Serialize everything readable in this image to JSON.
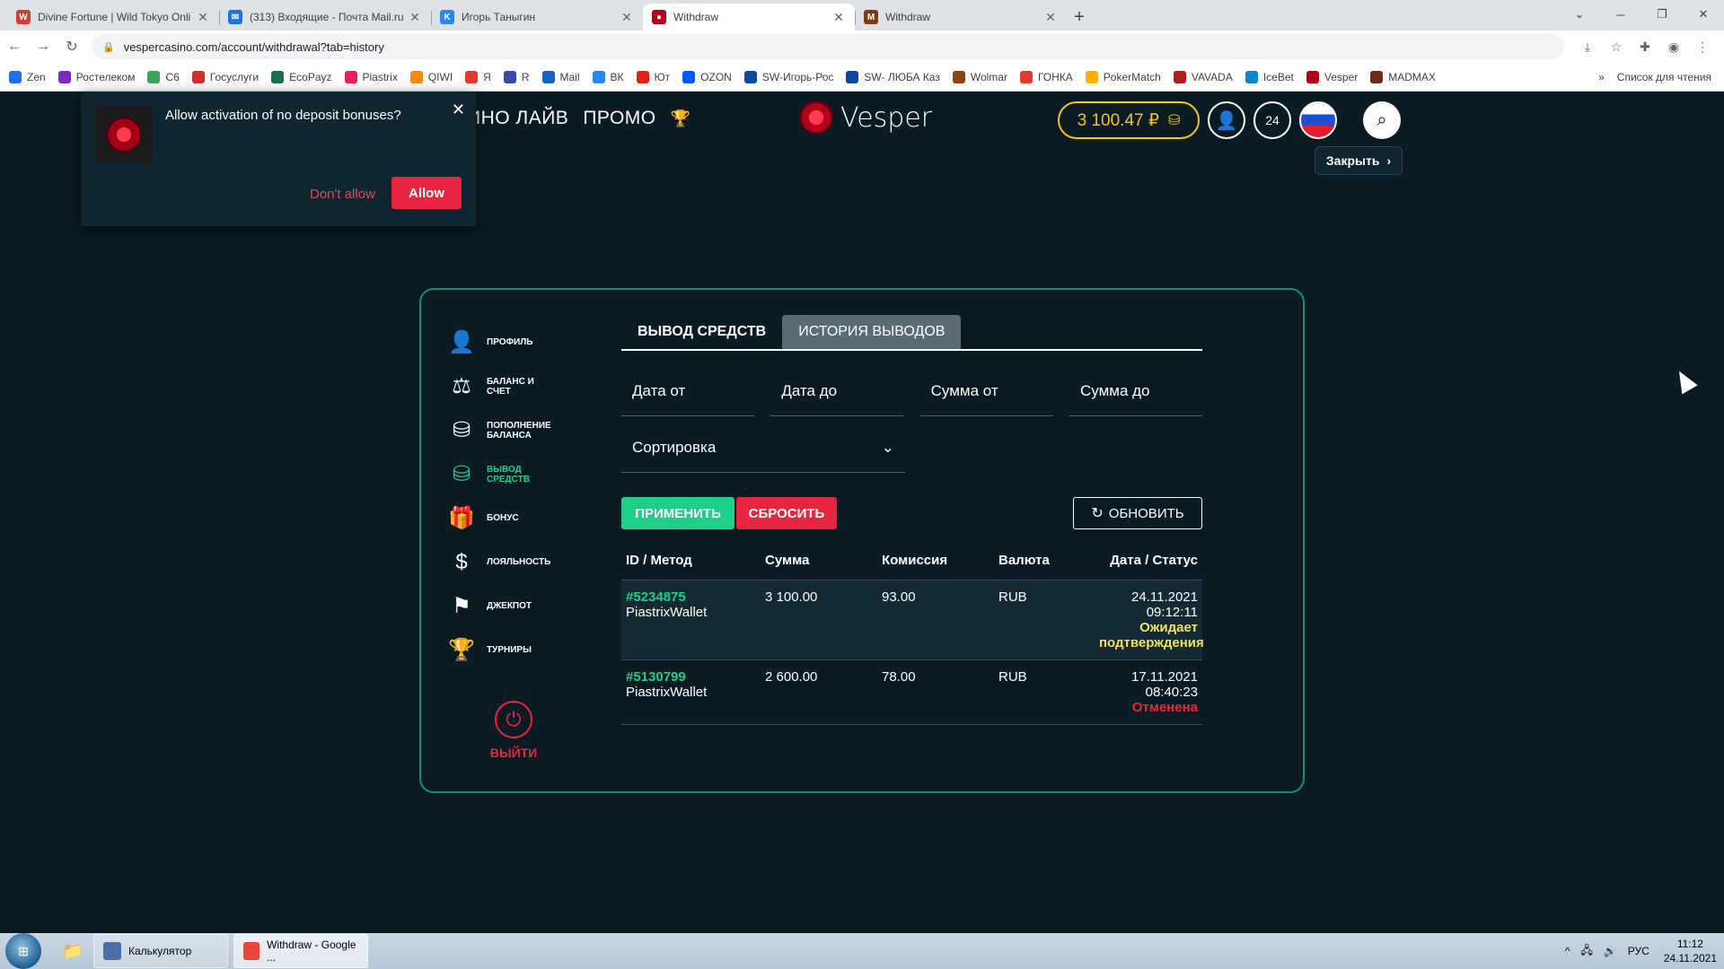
{
  "browser": {
    "tabs": [
      {
        "title": "Divine Fortune | Wild Tokyo Onli",
        "color": "#d23f31",
        "glyph": "W"
      },
      {
        "title": "(313) Входящие - Почта Mail.ru",
        "color": "#1a73e8",
        "glyph": "✉"
      },
      {
        "title": "Игорь Таныгин",
        "color": "#2787f5",
        "glyph": "K"
      },
      {
        "title": "Withdraw",
        "color": "#b3001b",
        "glyph": "●"
      },
      {
        "title": "Withdraw",
        "color": "#7a3b16",
        "glyph": "M"
      }
    ],
    "active_tab": 3,
    "url": "vespercasino.com/account/withdrawal?tab=history",
    "bookmarks": [
      {
        "label": "Zen",
        "color": "#1a73e8"
      },
      {
        "label": "Ростелеком",
        "color": "#7b2cbf"
      },
      {
        "label": "C6",
        "color": "#3aa657"
      },
      {
        "label": "Госуслуги",
        "color": "#d32f2f"
      },
      {
        "label": "EcoPayz",
        "color": "#1c6e4f"
      },
      {
        "label": "Piastrix",
        "color": "#e91e63"
      },
      {
        "label": "QIWI",
        "color": "#ff8c00"
      },
      {
        "label": "Я",
        "color": "#e53935"
      },
      {
        "label": "R",
        "color": "#3949ab"
      },
      {
        "label": "Mail",
        "color": "#1565c0"
      },
      {
        "label": "ВК",
        "color": "#2787f5"
      },
      {
        "label": "Ют",
        "color": "#e62117"
      },
      {
        "label": "OZON",
        "color": "#005bff"
      },
      {
        "label": "SW-Игорь-Рос",
        "color": "#0d47a1"
      },
      {
        "label": "SW- ЛЮБА Каз",
        "color": "#0d47a1"
      },
      {
        "label": "Wolmar",
        "color": "#8b4513"
      },
      {
        "label": "ГОНКА",
        "color": "#e53935"
      },
      {
        "label": "PokerMatch",
        "color": "#ffb300"
      },
      {
        "label": "VAVADA",
        "color": "#b71c1c"
      },
      {
        "label": "IceBet",
        "color": "#0288d1"
      },
      {
        "label": "Vesper",
        "color": "#b3001b"
      },
      {
        "label": "MADMAX",
        "color": "#6d2c14"
      }
    ],
    "more_glyph": "»",
    "reading_list": "Список для чтения"
  },
  "site": {
    "nav": [
      "ИНО ЛАЙВ",
      "ПРОМО"
    ],
    "logo": "Vesper",
    "balance": "3 100.47 ₽",
    "close_label": "Закрыть"
  },
  "notification": {
    "text": "Allow activation of no deposit bonuses?",
    "deny": "Don't allow",
    "allow": "Allow"
  },
  "sidebar": {
    "items": [
      {
        "label": "Профиль",
        "icon": "👤",
        "name": "profile",
        "active": false
      },
      {
        "label": "Баланс и счет",
        "icon": "⚖",
        "name": "balance",
        "active": false
      },
      {
        "label": "Пополнение баланса",
        "icon": "⛁",
        "name": "deposit",
        "active": false
      },
      {
        "label": "Вывод средств",
        "icon": "⛁",
        "name": "withdraw",
        "active": true
      },
      {
        "label": "Бонус",
        "icon": "🎁",
        "name": "bonus",
        "active": false
      },
      {
        "label": "Лояльность",
        "icon": "$",
        "name": "loyalty",
        "active": false
      },
      {
        "label": "Джекпот",
        "icon": "⚑",
        "name": "jackpot",
        "active": false
      },
      {
        "label": "Турниры",
        "icon": "🏆",
        "name": "tournaments",
        "active": false
      }
    ],
    "logout": "ВЫЙТИ"
  },
  "main": {
    "tabs": [
      {
        "label": "ВЫВОД СРЕДСТВ",
        "active": false
      },
      {
        "label": "ИСТОРИЯ ВЫВОДОВ",
        "active": true
      }
    ],
    "filters": {
      "date_from": "Дата от",
      "date_to": "Дата до",
      "sum_from": "Сумма от",
      "sum_to": "Сумма до",
      "sort": "Сортировка"
    },
    "buttons": {
      "apply": "ПРИМЕНИТЬ",
      "reset": "СБРОСИТЬ",
      "refresh": "ОБНОВИТЬ"
    },
    "table": {
      "headers": [
        "ID / Метод",
        "Сумма",
        "Комиссия",
        "Валюта",
        "Дата / Статус"
      ],
      "rows": [
        {
          "id": "#5234875",
          "method": "PiastrixWallet",
          "sum": "3 100.00",
          "fee": "93.00",
          "currency": "RUB",
          "date": "24.11.2021 09:12:11",
          "status": "Ожидает подтверждения",
          "status_type": "wait"
        },
        {
          "id": "#5130799",
          "method": "PiastrixWallet",
          "sum": "2 600.00",
          "fee": "78.00",
          "currency": "RUB",
          "date": "17.11.2021 08:40:23",
          "status": "Отменена",
          "status_type": "cancel"
        }
      ]
    }
  },
  "taskbar": {
    "apps": [
      {
        "label": "Калькулятор",
        "color": "#4a6fa5"
      },
      {
        "label": "Withdraw - Google ...",
        "color": "#e8453c"
      }
    ],
    "lang": "РУС",
    "time": "11:12",
    "date": "24.11.2021"
  }
}
